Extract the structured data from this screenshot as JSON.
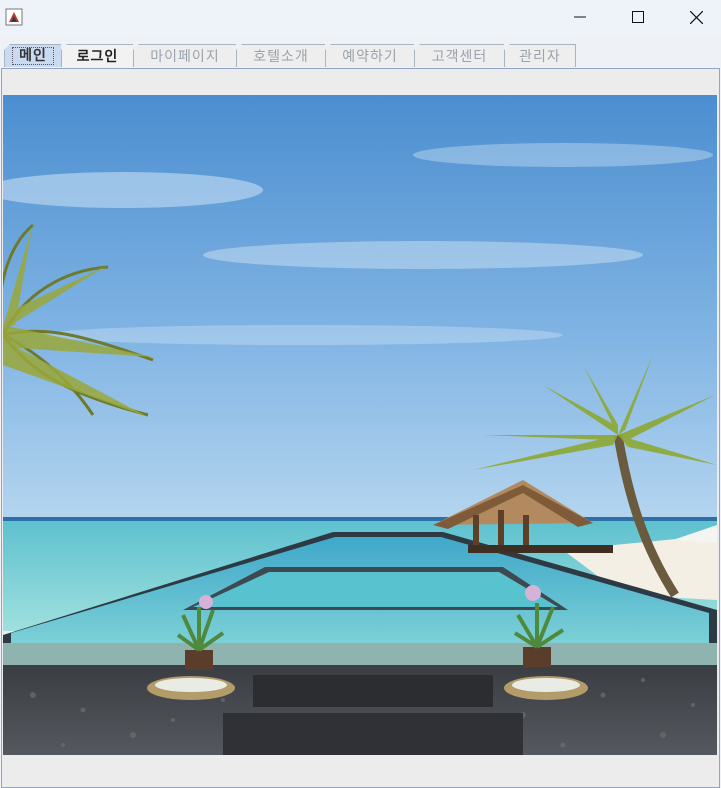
{
  "window": {
    "icon": "java-app-icon",
    "controls": [
      "minimize-icon",
      "maximize-icon",
      "close-icon"
    ]
  },
  "tabs": [
    {
      "label": "메인",
      "state": "selected"
    },
    {
      "label": "로그인",
      "state": "enabled"
    },
    {
      "label": "마이페이지",
      "state": "disabled"
    },
    {
      "label": "호텔소개",
      "state": "disabled"
    },
    {
      "label": "예약하기",
      "state": "disabled"
    },
    {
      "label": "고객센터",
      "state": "disabled"
    },
    {
      "label": "관리자",
      "state": "disabled"
    }
  ],
  "main": {
    "image": "resort-infinity-pool-photo"
  }
}
